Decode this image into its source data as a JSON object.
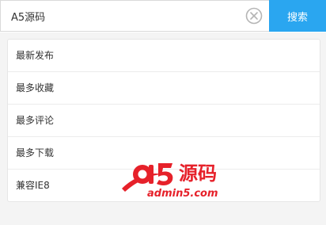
{
  "search": {
    "value": "A5源码",
    "button_label": "搜索"
  },
  "menu": {
    "items": [
      {
        "label": "最新发布"
      },
      {
        "label": "最多收藏"
      },
      {
        "label": "最多评论"
      },
      {
        "label": "最多下载"
      },
      {
        "label": "兼容IE8"
      }
    ]
  },
  "watermark": {
    "brand": "a5",
    "cn": "源码",
    "site": "admin5.com"
  },
  "colors": {
    "accent": "#2aa6f0",
    "brand_red": "#e6212a"
  }
}
